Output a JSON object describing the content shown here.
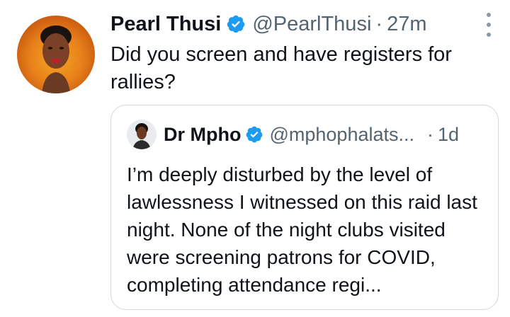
{
  "tweet": {
    "author_name": "Pearl Thusi",
    "handle": "@PearlThusi",
    "separator": "·",
    "time": "27m",
    "text": "Did you screen and have registers for rallies?",
    "avatar_icon": "profile-photo",
    "verified_icon": "verified-badge-icon",
    "more_icon": "more-options-icon"
  },
  "quoted_tweet": {
    "author_name": "Dr Mpho",
    "handle": "@mphophalats...",
    "separator": "·",
    "time": "1d",
    "text": "I’m deeply disturbed by the level of lawlessness I witnessed on this raid last night. None of the night clubs visited were screening patrons for COVID, completing attendance regi...",
    "avatar_icon": "profile-photo",
    "verified_icon": "verified-badge-icon"
  },
  "colors": {
    "text_primary": "#0f1419",
    "text_secondary": "#536471",
    "verified_blue": "#1d9bf0",
    "border": "#cfd9de"
  }
}
